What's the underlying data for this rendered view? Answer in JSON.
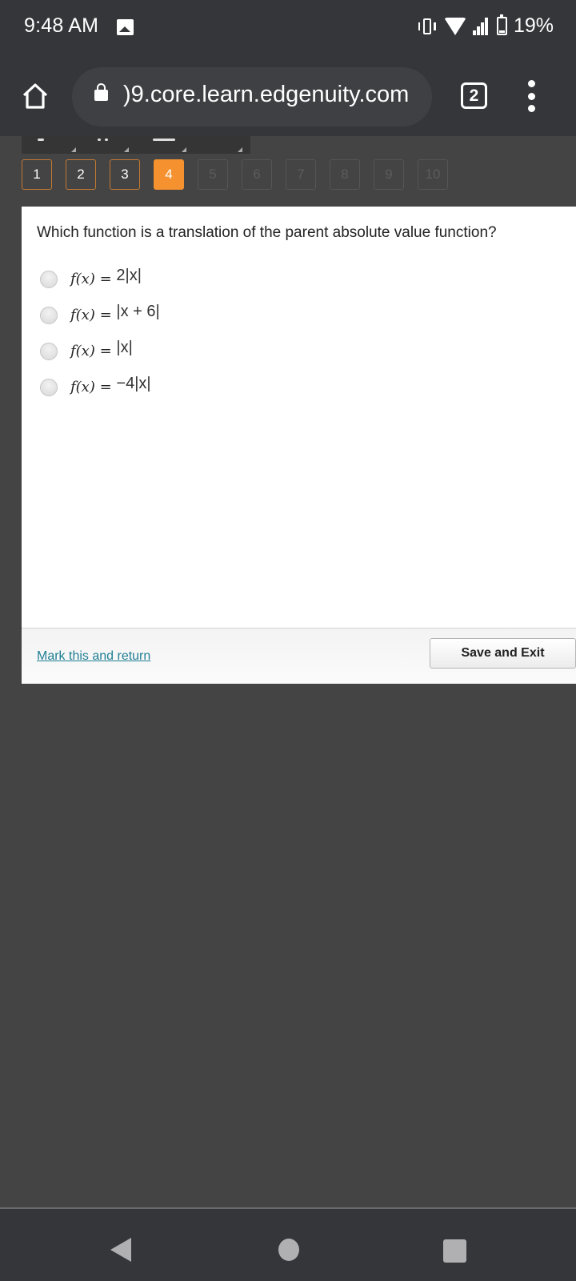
{
  "status_bar": {
    "time": "9:48 AM",
    "battery": "19%",
    "icons": [
      "image-notification-icon",
      "vibrate-icon",
      "wifi-icon",
      "signal-icon",
      "battery-icon"
    ]
  },
  "browser": {
    "url": ")9.core.learn.edgenuity.com",
    "tab_count": "2",
    "icons": [
      "home-icon",
      "lock-icon",
      "tabs-icon",
      "more-vert-icon"
    ]
  },
  "question_nav": {
    "items": [
      {
        "label": "1",
        "state": "answered"
      },
      {
        "label": "2",
        "state": "answered"
      },
      {
        "label": "3",
        "state": "answered"
      },
      {
        "label": "4",
        "state": "current"
      },
      {
        "label": "5",
        "state": "locked"
      },
      {
        "label": "6",
        "state": "locked"
      },
      {
        "label": "7",
        "state": "locked"
      },
      {
        "label": "8",
        "state": "locked"
      },
      {
        "label": "9",
        "state": "locked"
      },
      {
        "label": "10",
        "state": "locked"
      }
    ],
    "colors": {
      "current": "#f5922f",
      "answered_border": "#c47a33"
    }
  },
  "question": {
    "text": "Which function is a translation of the parent absolute value function?",
    "options": [
      {
        "prefix": "f(x) = ",
        "expr": "2|x|",
        "selected": false
      },
      {
        "prefix": "f(x) = ",
        "expr": "|x + 6|",
        "selected": false
      },
      {
        "prefix": "f(x) = ",
        "expr": "|x|",
        "selected": false
      },
      {
        "prefix": "f(x) = ",
        "expr": "−4|x|",
        "selected": false
      }
    ]
  },
  "footer": {
    "mark_link": "Mark this and return",
    "save_button": "Save and Exit",
    "link_color": "#1f7f93"
  },
  "nav_bar": {
    "icons": [
      "back-icon",
      "home-circle-icon",
      "recents-icon"
    ]
  }
}
